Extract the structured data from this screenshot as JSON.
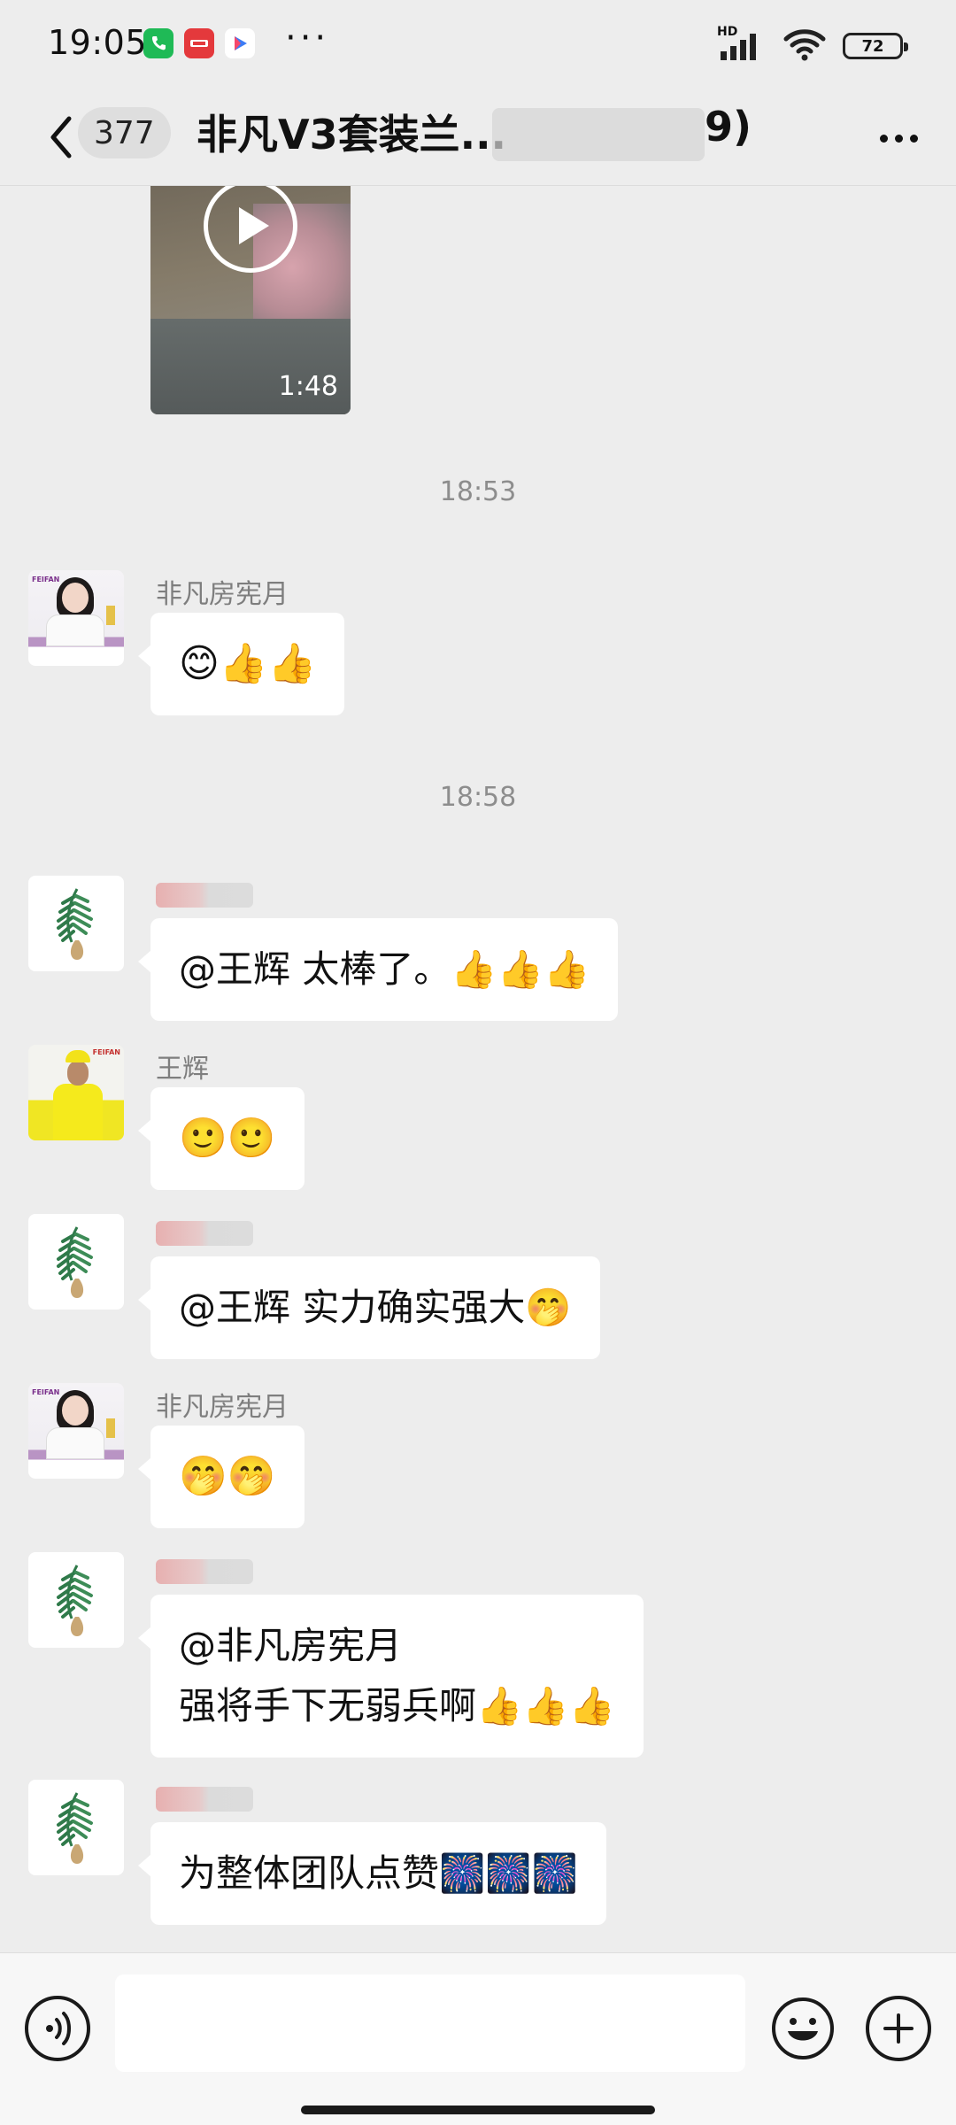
{
  "status_bar": {
    "time": "19:05",
    "battery": "72",
    "network": "HD",
    "more_dots": "···"
  },
  "header": {
    "unread_count": "377",
    "title": "非凡V3套装兰...",
    "title_suffix": "9)"
  },
  "video": {
    "duration": "1:48"
  },
  "timestamps": [
    "18:53",
    "18:58"
  ],
  "messages": [
    {
      "sender": "非凡房宪月",
      "text": "😊👍👍",
      "avatar": "woman-portrait"
    },
    {
      "sender": "",
      "text": "@王辉  太棒了。👍👍👍",
      "avatar": "leaf-logo"
    },
    {
      "sender": "王辉",
      "text": "🙂🙂",
      "avatar": "man-portrait"
    },
    {
      "sender": "",
      "text": "@王辉  实力确实强大🤭",
      "avatar": "leaf-logo"
    },
    {
      "sender": "非凡房宪月",
      "text": "🤭🤭",
      "avatar": "woman-portrait"
    },
    {
      "sender": "",
      "lines": [
        "@非凡房宪月",
        "强将手下无弱兵啊👍👍👍"
      ],
      "avatar": "leaf-logo"
    },
    {
      "sender": "",
      "text": "为整体团队点赞🎆🎆🎆",
      "avatar": "leaf-logo"
    }
  ],
  "input": {
    "value": "",
    "placeholder": ""
  },
  "colors": {
    "background": "#ededed",
    "bubble": "#ffffff",
    "sender_text": "#7e7e7e",
    "timestamp_text": "#8d8d8d"
  }
}
